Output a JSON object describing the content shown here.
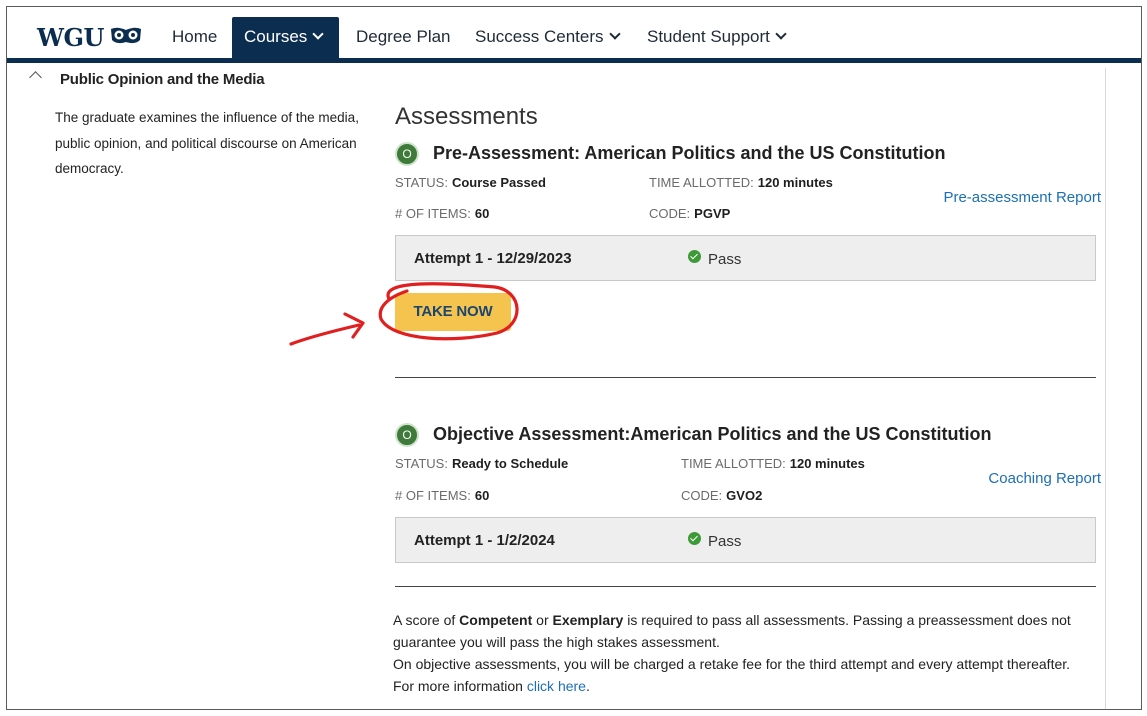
{
  "nav": {
    "logo_text": "WGU",
    "items": [
      {
        "label": "Home"
      },
      {
        "label": "Courses"
      },
      {
        "label": "Degree Plan"
      },
      {
        "label": "Success Centers"
      },
      {
        "label": "Student Support"
      }
    ]
  },
  "section": {
    "title": "Public Opinion and the Media",
    "description": "The graduate examines the influence of the media, public opinion, and political discourse on American democracy."
  },
  "assessments": {
    "heading": "Assessments",
    "items": [
      {
        "status_badge": "O",
        "title": "Pre-Assessment: American Politics and the US Constitution",
        "status_label": "STATUS:",
        "status_value": "Course Passed",
        "time_label": "TIME ALLOTTED:",
        "time_value": "120 minutes",
        "items_label": "# OF ITEMS:",
        "items_value": "60",
        "code_label": "CODE:",
        "code_value": "PGVP",
        "report_link": "Pre-assessment Report",
        "attempt_label": "Attempt 1 - 12/29/2023",
        "attempt_result": "Pass",
        "button_label": "TAKE NOW"
      },
      {
        "status_badge": "O",
        "title": "Objective Assessment:American Politics and the US Constitution",
        "status_label": "STATUS:",
        "status_value": "Ready to Schedule",
        "time_label": "TIME ALLOTTED:",
        "time_value": "120 minutes",
        "items_label": "# OF ITEMS:",
        "items_value": "60",
        "code_label": "CODE:",
        "code_value": "GVO2",
        "report_link": "Coaching Report",
        "attempt_label": "Attempt 1 - 1/2/2024",
        "attempt_result": "Pass"
      }
    ]
  },
  "note": {
    "part1": "A score of ",
    "competent": "Competent",
    "or": " or ",
    "exemplary": "Exemplary",
    "part2": " is required to pass all assessments. Passing a preassessment does not guarantee you will pass the high stakes assessment.",
    "line2": "On objective assessments, you will be charged a retake fee for the third attempt and every attempt thereafter. For more information ",
    "link": "click here",
    "end": "."
  },
  "colors": {
    "nav_dark": "#0b2d4f",
    "button_yellow": "#f5c44f",
    "link_blue": "#1d6fb5",
    "status_green": "#3e7b3a",
    "annotation_red": "#e02020"
  }
}
